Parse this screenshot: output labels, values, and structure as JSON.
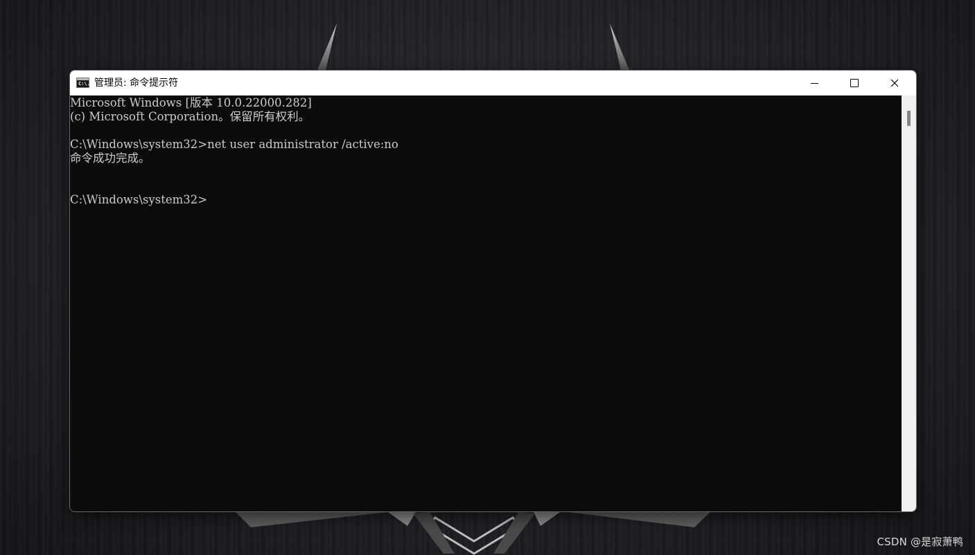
{
  "window": {
    "title": "管理员: 命令提示符",
    "icon_text": "C:\\.",
    "icon": "cmd-icon"
  },
  "controls": {
    "minimize": "minimize-icon",
    "maximize": "maximize-icon",
    "close": "close-icon",
    "close_glyph": "✕"
  },
  "console": {
    "lines": [
      "Microsoft Windows [版本 10.0.22000.282]",
      "(c) Microsoft Corporation。保留所有权利。",
      "",
      "C:\\Windows\\system32>net user administrator /active:no",
      "命令成功完成。",
      "",
      "",
      "C:\\Windows\\system32>"
    ],
    "colors": {
      "background": "#0c0c0c",
      "foreground": "#cccccc"
    }
  },
  "watermark": "CSDN @是寂萧鸭"
}
